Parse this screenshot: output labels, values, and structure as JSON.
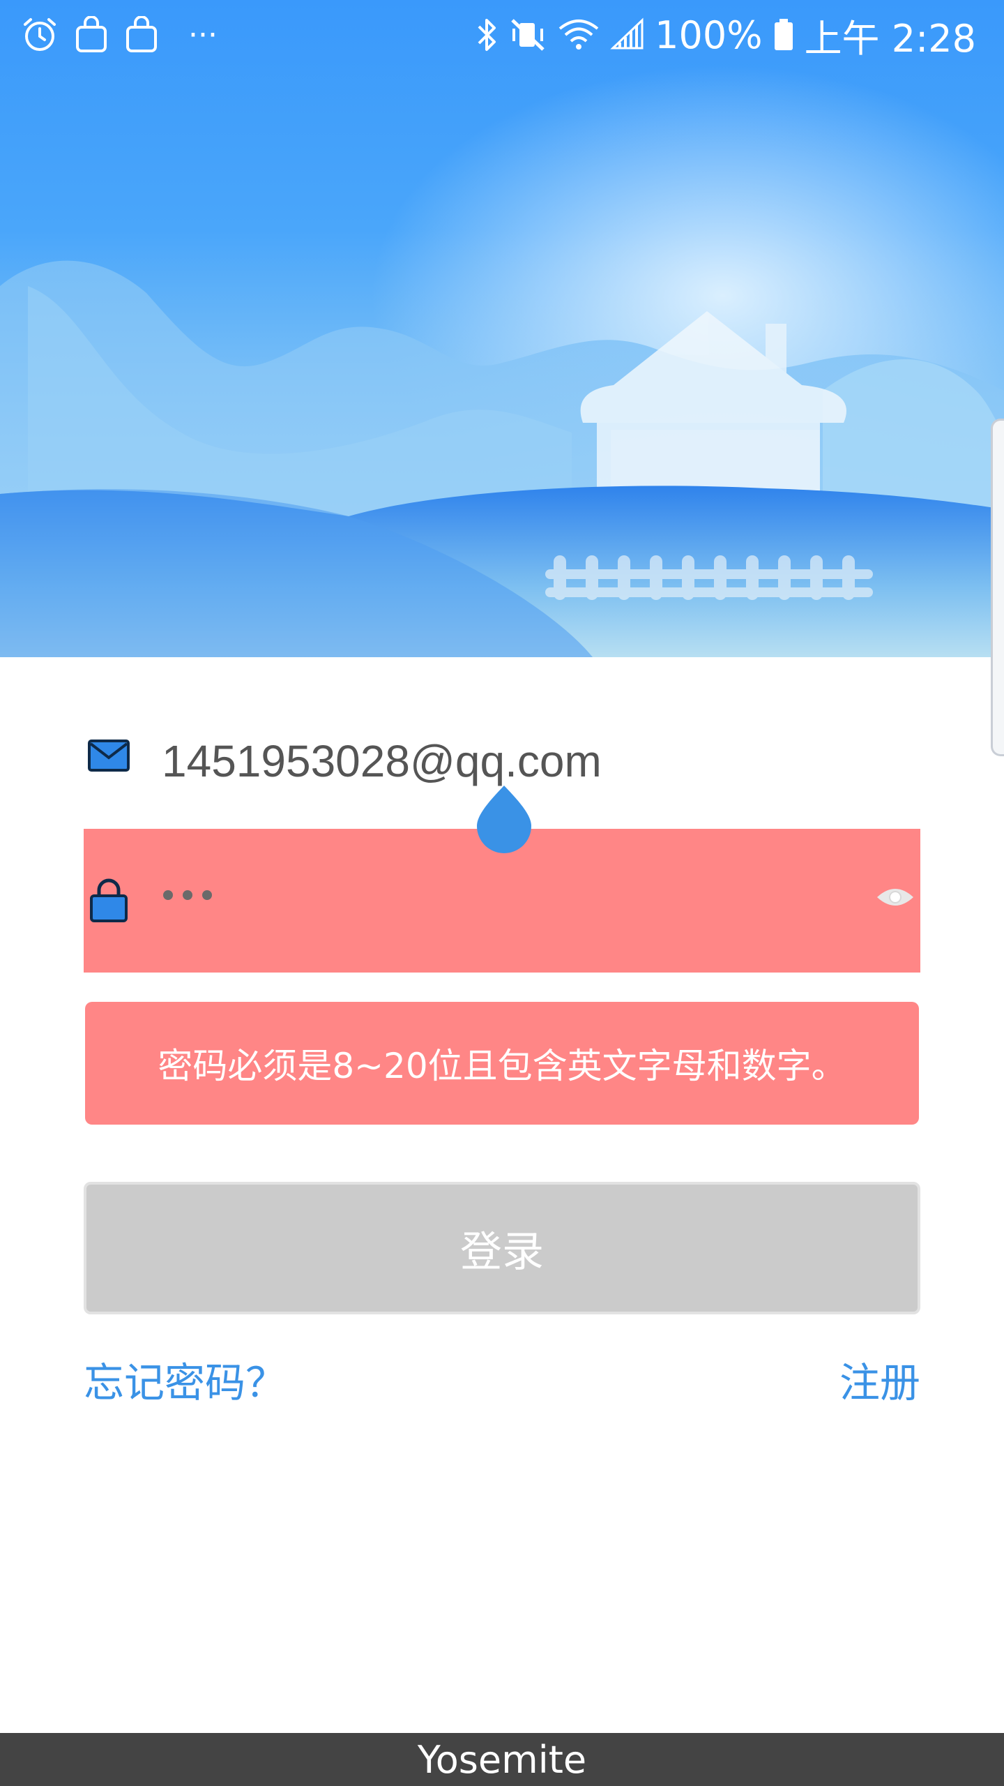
{
  "status_bar": {
    "battery": "100%",
    "time": "上午 2:28",
    "more_label": "···"
  },
  "form": {
    "email_value": "1451953028@qq.com",
    "error_message": "密码必须是8~20位且包含英文字母和数字。",
    "login_label": "登录",
    "forgot_label": "忘记密码？",
    "register_label": "注册"
  },
  "colors": {
    "accent": "#3a92e6",
    "error_bg": "#ff8686",
    "button_disabled": "#cbcbcb",
    "sky": "#3b9bfb"
  },
  "caption": "Yosemite"
}
